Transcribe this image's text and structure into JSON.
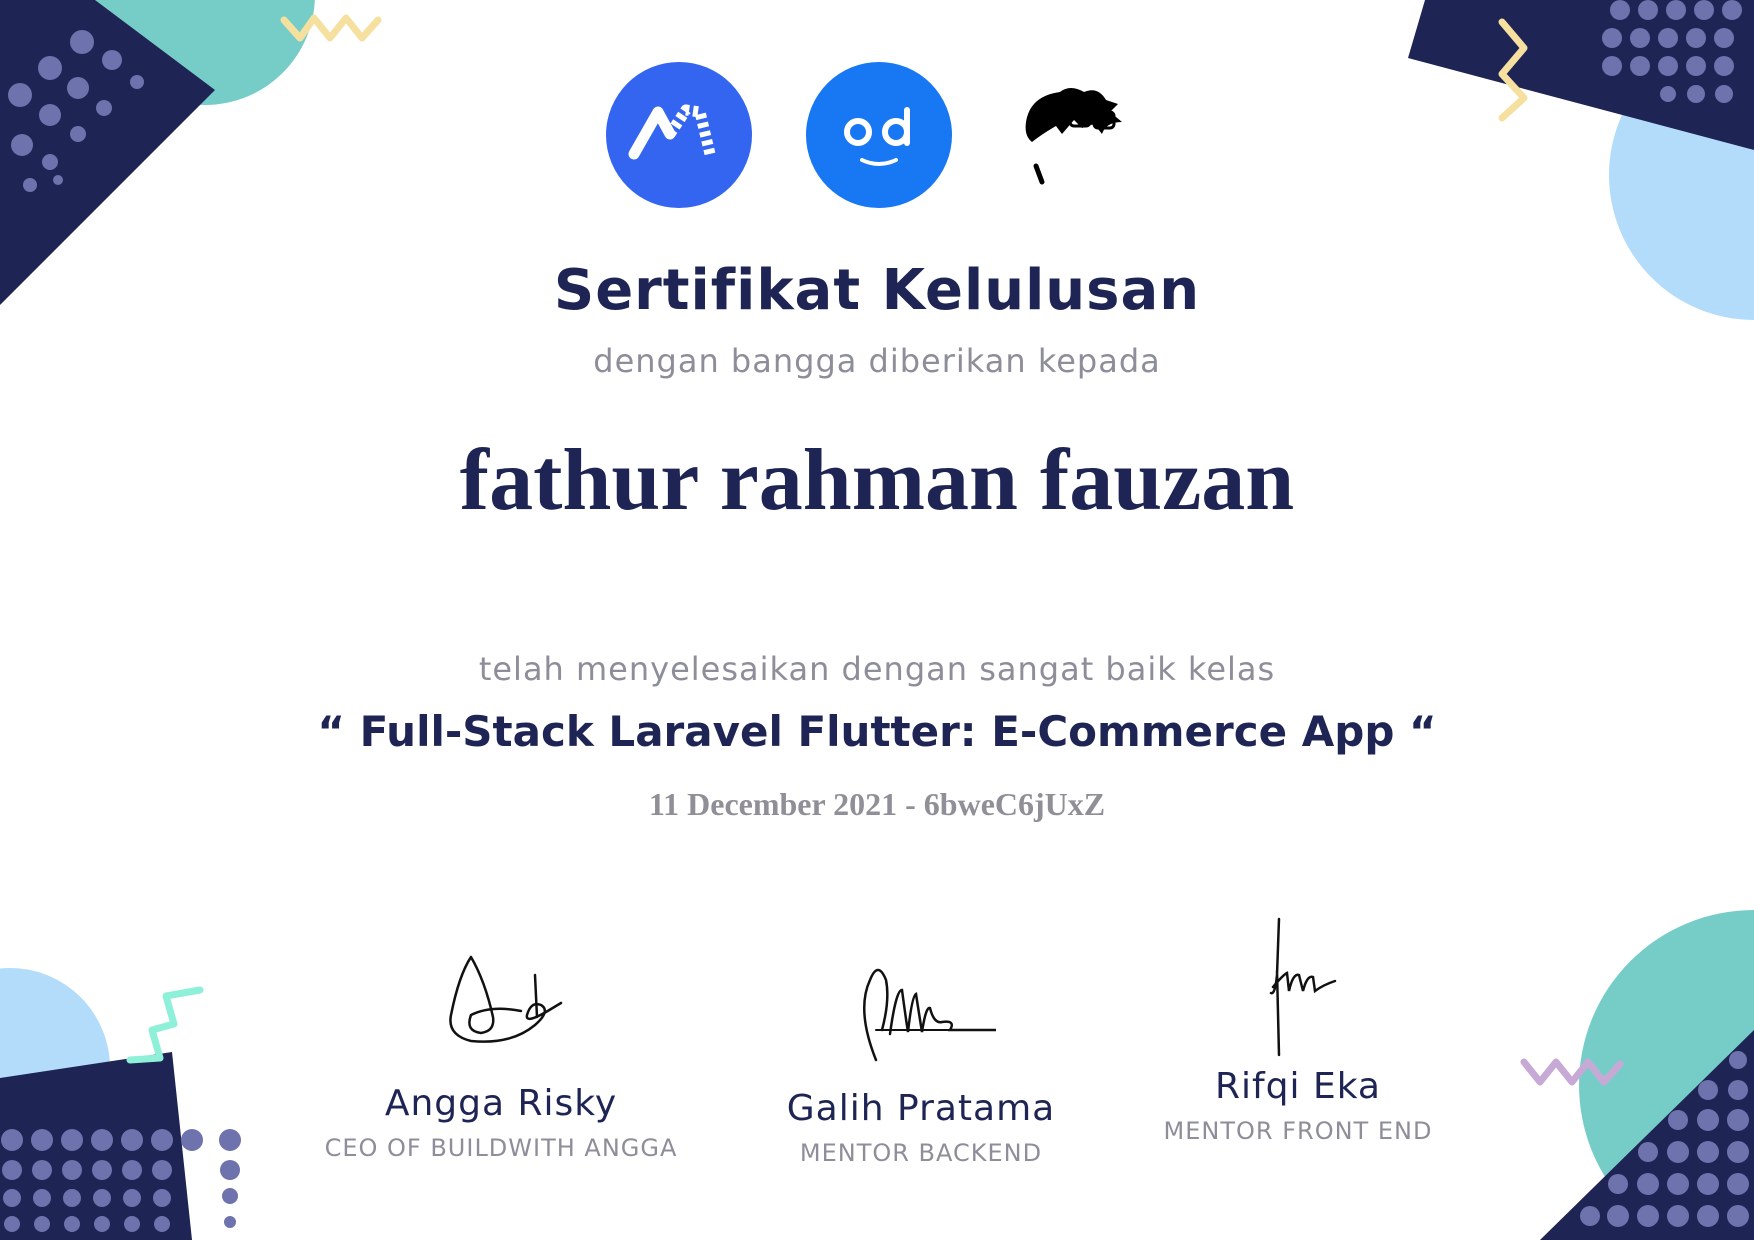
{
  "certificate": {
    "title": "Sertifikat Kelulusan",
    "subtitle": "dengan bangga diberikan kepada",
    "recipient_name": "fathur rahman fauzan",
    "completion_text": "telah menyelesaikan dengan sangat baik kelas",
    "course_title": "“ Full-Stack Laravel Flutter: E-Commerce App “",
    "date_code": "11 December 2021 - 6bweC6jUxZ"
  },
  "logos": [
    {
      "icon": "buildwithangga-logo-icon",
      "color": "#3465f0"
    },
    {
      "icon": "od-logo-icon",
      "color": "#1877f2"
    },
    {
      "icon": "mentor-avatar-icon",
      "color": "#000000"
    }
  ],
  "signers": [
    {
      "name": "Angga Risky",
      "role": "CEO OF BUILDWITH ANGGA"
    },
    {
      "name": "Galih Pratama",
      "role": "MENTOR BACKEND"
    },
    {
      "name": "Rifqi Eka",
      "role": "MENTOR FRONT END"
    }
  ],
  "colors": {
    "navy": "#1e2454",
    "teal": "#76cdc8",
    "light_blue": "#b3dcfb",
    "yellow": "#f6e0a0",
    "mint": "#8ef0d8",
    "lavender": "#c7a9d6",
    "dot": "#6e72ad",
    "gray_text": "#8e8e9a"
  }
}
